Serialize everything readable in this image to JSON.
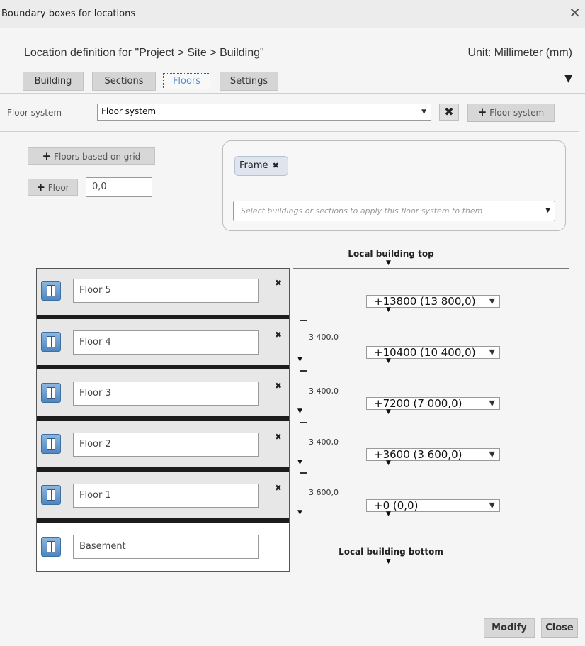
{
  "window": {
    "title": "Boundary boxes for locations",
    "close_glyph": "✕"
  },
  "header": {
    "heading": "Location definition for \"Project > Site > Building\"",
    "unit": "Unit: Millimeter (mm)"
  },
  "tabs": [
    {
      "label": "Building"
    },
    {
      "label": "Sections"
    },
    {
      "label": "Floors",
      "active": true
    },
    {
      "label": "Settings"
    }
  ],
  "tabs_menu_glyph": "▼",
  "floor_system": {
    "label": "Floor system",
    "value": "Floor system",
    "remove_glyph": "✖",
    "add_label": "Floor system"
  },
  "actions": {
    "floors_based_on_grid_label": "Floors based on grid",
    "add_floor_label": "Floor",
    "floor_height_value": "0,0"
  },
  "apply": {
    "chips": [
      {
        "label": "Frame"
      }
    ],
    "select_placeholder": "Select buildings or sections to apply this floor system to them"
  },
  "levels": {
    "top_label": "Local building top",
    "bottom_label": "Local building bottom"
  },
  "floors": [
    {
      "name": "Floor 5",
      "elevation": "+13800 (13 800,0)",
      "height": ""
    },
    {
      "name": "Floor 4",
      "elevation": "+10400 (10 400,0)",
      "height": "3 400,0"
    },
    {
      "name": "Floor 3",
      "elevation": "+7200 (7 000,0)",
      "height": "3 400,0"
    },
    {
      "name": "Floor 2",
      "elevation": "+3600 (3 600,0)",
      "height": "3 400,0"
    },
    {
      "name": "Floor 1",
      "elevation": "+0 (0,0)",
      "height": "3 600,0"
    },
    {
      "name": "Basement"
    }
  ],
  "footer": {
    "modify_label": "Modify",
    "close_label": "Close"
  },
  "colors": {
    "active_tab_text": "#4b8fd1",
    "floor_icon": "#6a9fd4",
    "chip_bg": "#dfe5ee"
  },
  "icons": {
    "plus": "plus-icon",
    "floor": "floor-plan-icon",
    "dropdown": "chevron-down-icon",
    "remove": "close-icon"
  }
}
